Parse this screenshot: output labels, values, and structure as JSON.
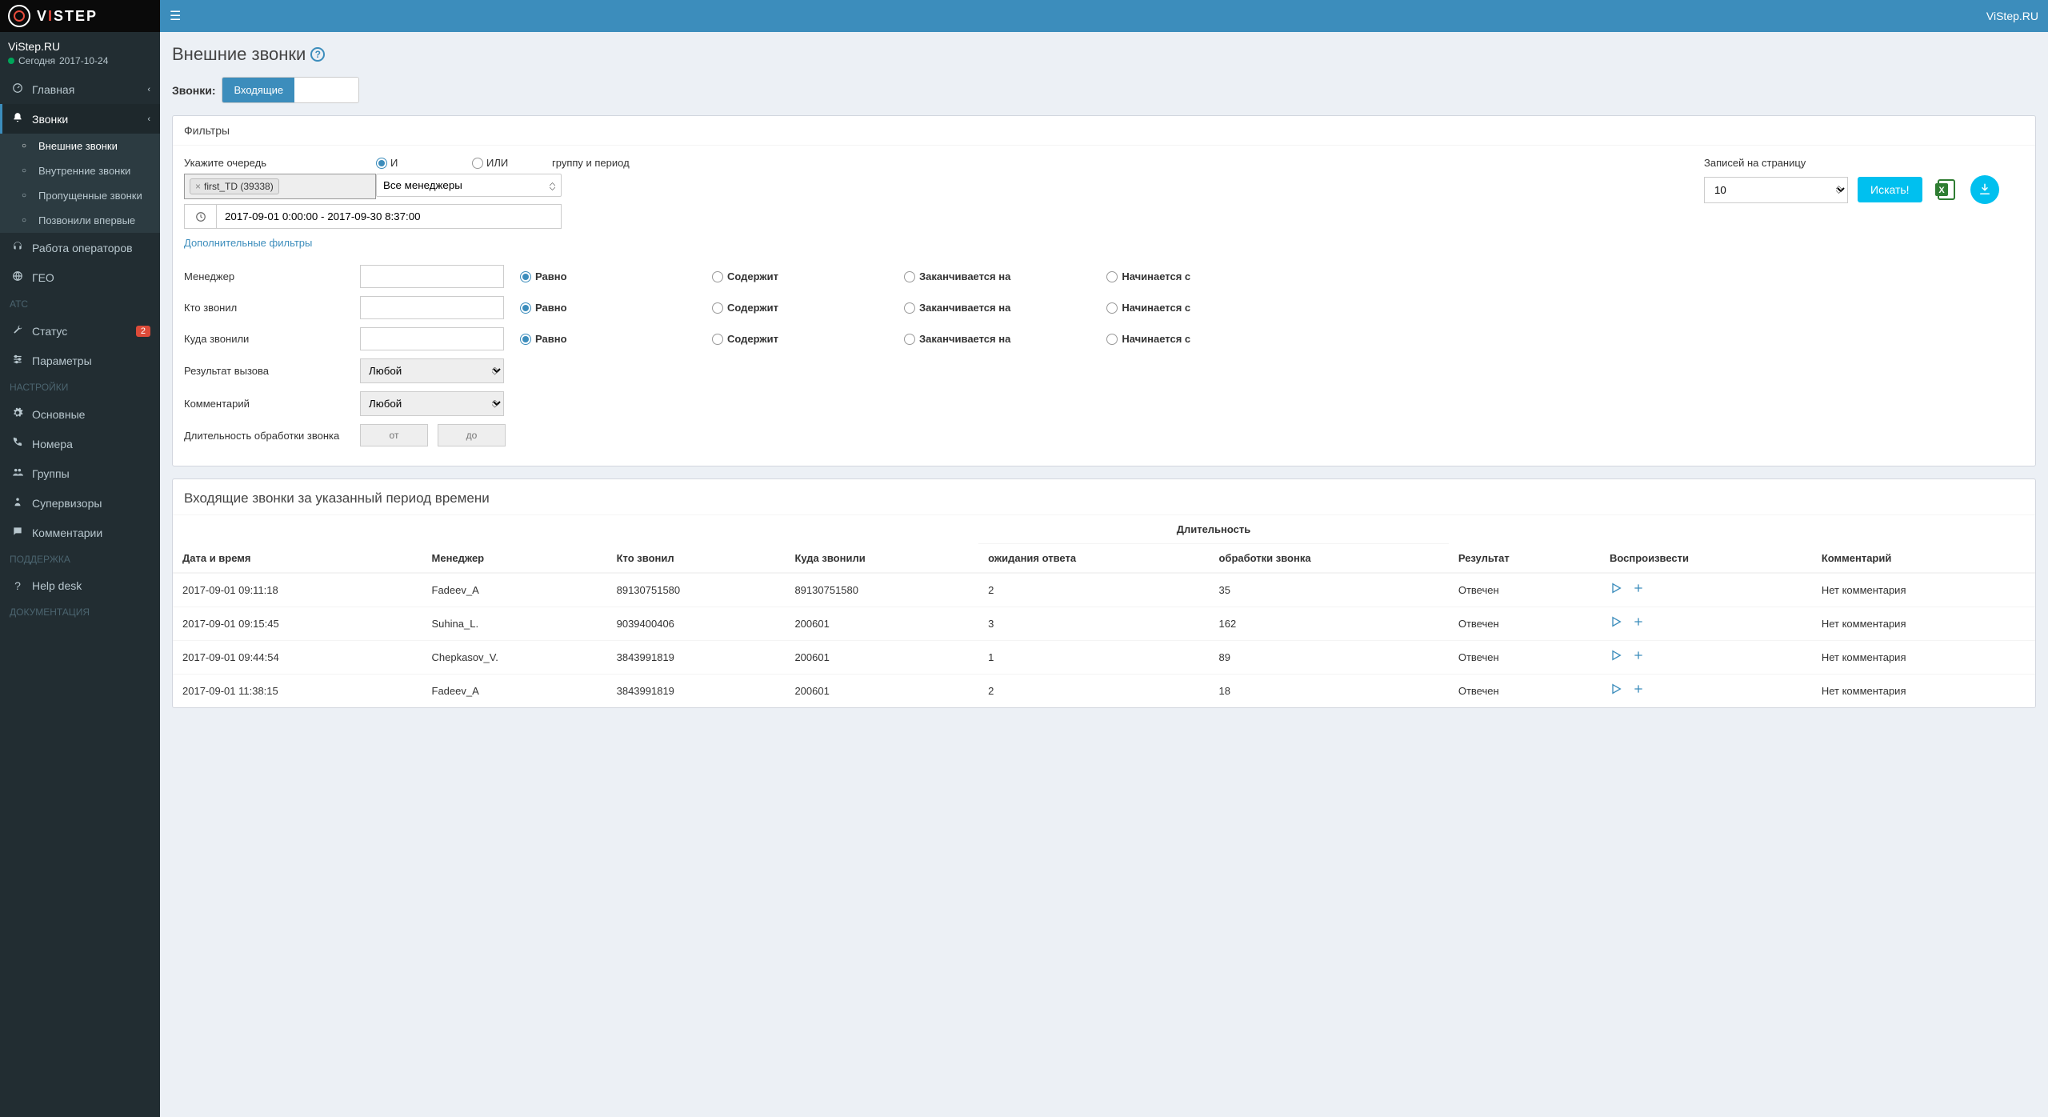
{
  "brand": {
    "name": "VISTEP",
    "right_label": "ViStep.RU"
  },
  "user": {
    "name": "ViStep.RU",
    "date_prefix": "Сегодня",
    "date": "2017-10-24"
  },
  "sidebar": {
    "items": [
      {
        "icon": "dashboard",
        "label": "Главная",
        "chev": true
      },
      {
        "icon": "bell",
        "label": "Звонки",
        "chev": true,
        "active": true
      },
      {
        "icon": "headset",
        "label": "Работа операторов"
      },
      {
        "icon": "globe",
        "label": "ГЕО"
      }
    ],
    "calls_sub": [
      {
        "label": "Внешние звонки",
        "active": true
      },
      {
        "label": "Внутренние звонки"
      },
      {
        "label": "Пропущенные звонки"
      },
      {
        "label": "Позвонили впервые"
      }
    ],
    "atc_header": "АТС",
    "atc": [
      {
        "icon": "wrench",
        "label": "Статус",
        "badge": "2"
      },
      {
        "icon": "sliders",
        "label": "Параметры"
      }
    ],
    "settings_header": "НАСТРОЙКИ",
    "settings": [
      {
        "icon": "gear",
        "label": "Основные"
      },
      {
        "icon": "phone",
        "label": "Номера"
      },
      {
        "icon": "users",
        "label": "Группы"
      },
      {
        "icon": "person",
        "label": "Супервизоры"
      },
      {
        "icon": "comment",
        "label": "Комментарии"
      }
    ],
    "support_header": "ПОДДЕРЖКА",
    "support": [
      {
        "icon": "question",
        "label": "Help desk"
      }
    ],
    "docs_header": "ДОКУМЕНТАЦИЯ"
  },
  "page": {
    "title": "Внешние звонки",
    "calls_label": "Звонки:",
    "tab_incoming": "Входящие",
    "filters_title": "Фильтры",
    "lbl_queue": "Укажите очередь",
    "lbl_and": "И",
    "lbl_or": "ИЛИ",
    "lbl_group_period": "группу и период",
    "queue_tag": "first_TD (39338)",
    "mgr_select": "Все менеджеры",
    "date_range": "2017-09-01 0:00:00 - 2017-09-30 8:37:00",
    "per_page_label": "Записей на страницу",
    "per_page_value": "10",
    "search_btn": "Искать!",
    "adv_link": "Дополнительные фильтры",
    "adv": {
      "manager": "Менеджер",
      "caller": "Кто звонил",
      "callee": "Куда звонили",
      "result": "Результат вызова",
      "comment": "Комментарий",
      "duration": "Длительность обработки звонка",
      "any": "Любой",
      "from": "от",
      "to": "до",
      "opt_equals": "Равно",
      "opt_contains": "Содержит",
      "opt_endswith": "Заканчивается на",
      "opt_startswith": "Начинается с"
    }
  },
  "table": {
    "title": "Входящие звонки за указанный период времени",
    "headers": {
      "datetime": "Дата и время",
      "manager": "Менеджер",
      "caller": "Кто звонил",
      "callee": "Куда звонили",
      "duration_group": "Длительность",
      "wait": "ожидания ответа",
      "handle": "обработки звонка",
      "result": "Результат",
      "play": "Воспроизвести",
      "comment": "Комментарий"
    },
    "rows": [
      {
        "dt": "2017-09-01 09:11:18",
        "mgr": "Fadeev_A",
        "caller": "89130751580",
        "callee": "89130751580",
        "wait": "2",
        "handle": "35",
        "result": "Отвечен",
        "comment": "Нет комментария"
      },
      {
        "dt": "2017-09-01 09:15:45",
        "mgr": "Suhina_L.",
        "caller": "9039400406",
        "callee": "200601",
        "wait": "3",
        "handle": "162",
        "result": "Отвечен",
        "comment": "Нет комментария"
      },
      {
        "dt": "2017-09-01 09:44:54",
        "mgr": "Chepkasov_V.",
        "caller": "3843991819",
        "callee": "200601",
        "wait": "1",
        "handle": "89",
        "result": "Отвечен",
        "comment": "Нет комментария"
      },
      {
        "dt": "2017-09-01 11:38:15",
        "mgr": "Fadeev_A",
        "caller": "3843991819",
        "callee": "200601",
        "wait": "2",
        "handle": "18",
        "result": "Отвечен",
        "comment": "Нет комментария"
      }
    ]
  }
}
